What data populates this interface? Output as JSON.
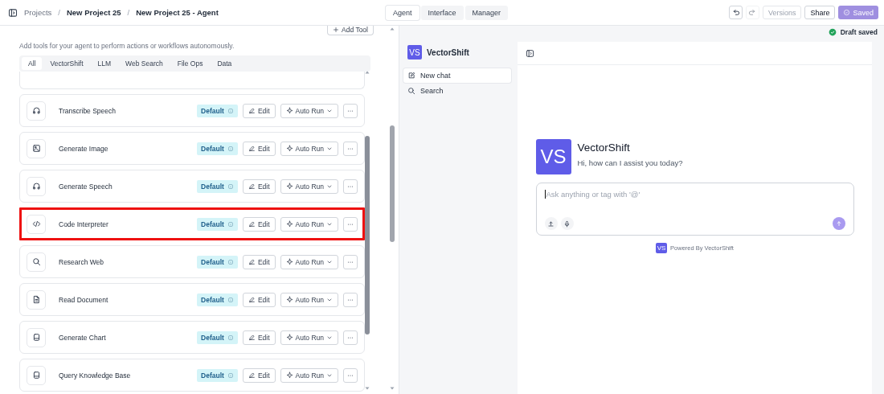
{
  "breadcrumbs": [
    {
      "kind": "link",
      "label": "Projects",
      "muted": true
    },
    {
      "kind": "separator",
      "label": "/"
    },
    {
      "kind": "link",
      "label": "New Project 25",
      "muted": false
    },
    {
      "kind": "separator",
      "label": "/"
    },
    {
      "kind": "link",
      "label": "New Project 25 - Agent",
      "muted": false
    }
  ],
  "view_tabs": [
    {
      "label": "Agent",
      "selected": true
    },
    {
      "label": "Interface",
      "selected": false
    },
    {
      "label": "Manager",
      "selected": false
    }
  ],
  "toolbar": [
    {
      "kind": "undo",
      "disabled": false
    },
    {
      "kind": "redo",
      "disabled": true
    },
    {
      "kind": "text",
      "label": "Versions",
      "disabled": true
    },
    {
      "kind": "text",
      "label": "Share",
      "disabled": false
    },
    {
      "kind": "saved",
      "label": "Saved",
      "disabled": true
    }
  ],
  "tools_panel": {
    "add_button": "Add Tool",
    "description": "Add tools for your agent to perform actions or workflows autonomously.",
    "filters": [
      {
        "label": "All",
        "selected": true
      },
      {
        "label": "VectorShift",
        "selected": false
      },
      {
        "label": "LLM",
        "selected": false
      },
      {
        "label": "Web Search",
        "selected": false
      },
      {
        "label": "File Ops",
        "selected": false
      },
      {
        "label": "Data",
        "selected": false
      }
    ],
    "tools": [
      {
        "kind": "speech",
        "name": "Transcribe Speech",
        "badge": "Default",
        "edit": "Edit",
        "run": "Auto Run",
        "highlighted": false
      },
      {
        "kind": "image",
        "name": "Generate Image",
        "badge": "Default",
        "edit": "Edit",
        "run": "Auto Run",
        "highlighted": false
      },
      {
        "kind": "speech",
        "name": "Generate Speech",
        "badge": "Default",
        "edit": "Edit",
        "run": "Auto Run",
        "highlighted": false
      },
      {
        "kind": "code",
        "name": "Code Interpreter",
        "badge": "Default",
        "edit": "Edit",
        "run": "Auto Run",
        "highlighted": true
      },
      {
        "kind": "search",
        "name": "Research Web",
        "badge": "Default",
        "edit": "Edit",
        "run": "Auto Run",
        "highlighted": false
      },
      {
        "kind": "document",
        "name": "Read Document",
        "badge": "Default",
        "edit": "Edit",
        "run": "Auto Run",
        "highlighted": false
      },
      {
        "kind": "book",
        "name": "Generate Chart",
        "badge": "Default",
        "edit": "Edit",
        "run": "Auto Run",
        "highlighted": false
      },
      {
        "kind": "book",
        "name": "Query Knowledge Base",
        "badge": "Default",
        "edit": "Edit",
        "run": "Auto Run",
        "highlighted": false
      }
    ]
  },
  "draft_status": "Draft saved",
  "chat": {
    "logo": "VS",
    "brand": "VectorShift",
    "sidebar_items": [
      {
        "kind": "new",
        "label": "New chat",
        "selected": true
      },
      {
        "kind": "search",
        "label": "Search",
        "selected": false
      }
    ],
    "hero_logo": "VS",
    "hero_title": "VectorShift",
    "greeting": "Hi, how can I assist you today?",
    "input_placeholder": "Ask anything or tag with '@'",
    "powered_logo": "VS",
    "powered_by": "Powered By VectorShift"
  }
}
